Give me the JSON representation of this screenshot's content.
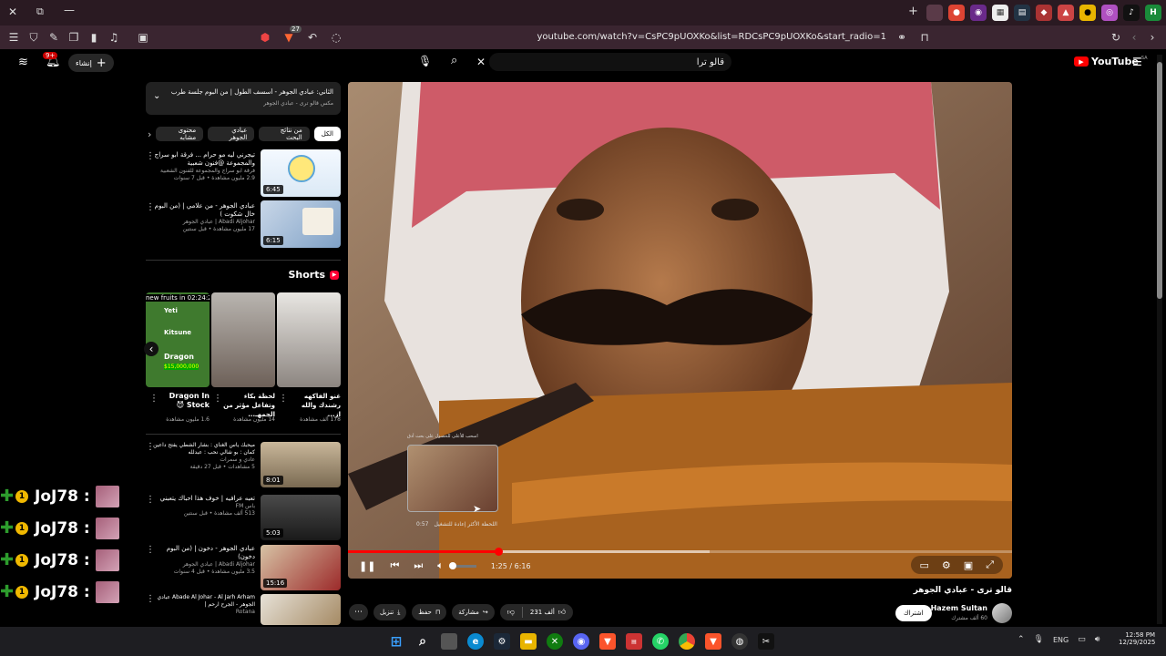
{
  "browser": {
    "url": "youtube.com/watch?v=CsPC9pUOXKo&list=RDCsPC9pUOXKo&start_radio=1",
    "badge_count": "27"
  },
  "youtube": {
    "logo_text": "YouTube",
    "logo_region": "SA",
    "search_value": "قالو ترا",
    "create_label": "إنشاء",
    "notif_count": "9+"
  },
  "playlist": {
    "title": "الثاني: عبادي الجوهر - أسسف الطول | من البوم جلسة طرب 1998",
    "subtitle": "مكس قالو ترى - عبادي الجوهر"
  },
  "chips": [
    "الكل",
    "من نتائج البحث",
    "عبادي الجوهر",
    "محتوى مشابه"
  ],
  "top_videos": [
    {
      "title": "تيجرني ليه مو حرام ... فرقة ابو سراج والمجموعة @فنون شعبية",
      "channel": "فرقة ابو سراج والمجموعة للفنون الشعبية",
      "meta": "2.9 مليون مشاهدة • قبل 7 سنوات",
      "duration": "6:45"
    },
    {
      "title": "عبادي الجوهر - من علامي | (من البوم خال شكوت )",
      "channel": "Abadi Aljohar | عبادي الجوهر",
      "meta": "17 مليون مشاهدة • قبل سنتين",
      "duration": "6:15"
    }
  ],
  "shorts": {
    "label": "Shorts",
    "items": [
      {
        "title": "Dragon In Stock 😈",
        "meta": "1.6 مليون مشاهدة",
        "thumb_text": "new fruits in 02:24:27"
      },
      {
        "title": "لحظة بكاء وتفاعل مؤثر من الجمهـ...",
        "meta": "14 مليون مشاهدة"
      },
      {
        "title": "غنو الفاكهه رشندك والله از...",
        "meta": "178 ألف مشاهدة"
      }
    ],
    "fruit_labels": [
      "Yeti",
      "Kitsune",
      "Dragon",
      "$15,000,000"
    ]
  },
  "bottom_videos": [
    {
      "title": "ميحبك ياس الغناي : بشار الشطي يفتح داعين كمان : بو شالي نحب : عبدلله",
      "channel": "عادي و سمرات",
      "meta": "5 مشاهدات • قبل 27 دقيقة",
      "duration": "8:01"
    },
    {
      "title": "تعبه عرافيه | خوف هذا احباك يتعبني",
      "channel": "باس FM",
      "meta": "513 ألف مشاهدة • قبل سنتين",
      "duration": "5:03"
    },
    {
      "title": "عبادي الجوهر - دخون | (من البوم دخون)",
      "channel": "Abadi Aljohar | عبادي الجوهر",
      "meta": "3.5 مليون مشاهدة • قبل 4 سنوات",
      "duration": "15:16"
    },
    {
      "title": "Abade Al Johar - Al Jarh Arham عبادي الجوهر - الجرح ارحم |",
      "channel": "Rotana",
      "meta": "",
      "duration": ""
    }
  ],
  "player": {
    "time": "1:25 / 6:16",
    "progress": 0.227,
    "buffered": 0.545,
    "hover_time": "0:57",
    "hover_label": "اللحظة الأكثر إعادة للتشغيل",
    "hover_hint": "اسحب للأعلى للحصول على بحث أدق"
  },
  "video": {
    "title": "قالو ترى - عبادي الجوهر",
    "channel": "Hazem Sultan",
    "subs": "60 ألف مشترك",
    "subscribe_label": "اشتراك",
    "likes": "231 ألف",
    "share_label": "مشاركة",
    "save_label": "حفظ",
    "download_label": "تنزيل"
  },
  "overlay": {
    "rows": [
      "JoJ78 :",
      "JoJ78 :",
      "JoJ78 :",
      "JoJ78 :"
    ]
  },
  "taskbar": {
    "lang": "ENG",
    "time": "12:58 PM",
    "date": "12/29/2025"
  }
}
